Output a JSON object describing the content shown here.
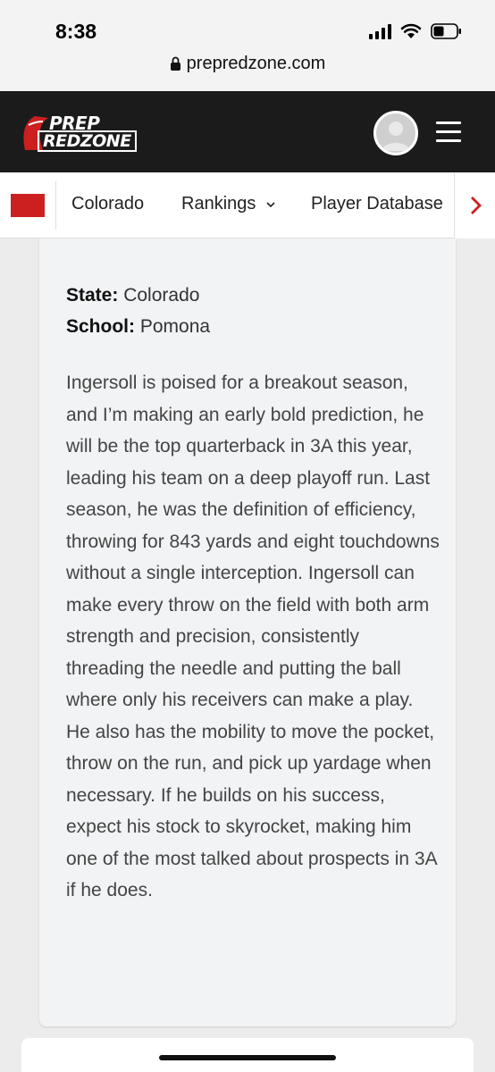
{
  "status_bar": {
    "time": "8:38"
  },
  "browser": {
    "url": "prepredzone.com"
  },
  "header": {
    "logo_line1": "PREP",
    "logo_line2": "REDZONE"
  },
  "nav": {
    "items": [
      {
        "label": "Colorado"
      },
      {
        "label": "Rankings"
      },
      {
        "label": "Player Database"
      }
    ]
  },
  "profile": {
    "state_label": "State:",
    "state_value": "Colorado",
    "school_label": "School:",
    "school_value": "Pomona",
    "description": "Ingersoll is poised for a breakout season, and I’m making an early bold prediction, he will be the top quarterback in 3A this year, leading his team on a deep playoff run. Last season, he was the definition of efficiency, throwing for 843 yards and eight touchdowns without a single interception. Ingersoll can make every throw on the field with both arm strength and precision, consistently threading the needle and putting the ball where only his receivers can make a play. He also has the mobility to move the pocket, throw on the run, and pick up yardage when necessary. If he builds on his success, expect his stock to skyrocket, making him one of the most talked about prospects in 3A if he does."
  },
  "colors": {
    "brand_red": "#cc1f1f",
    "header_bg": "#1b1b1b",
    "card_bg": "#f2f3f5"
  },
  "icons": {
    "lock": "lock-icon",
    "menu": "hamburger-menu-icon",
    "chevron": "chevron-right-icon"
  }
}
